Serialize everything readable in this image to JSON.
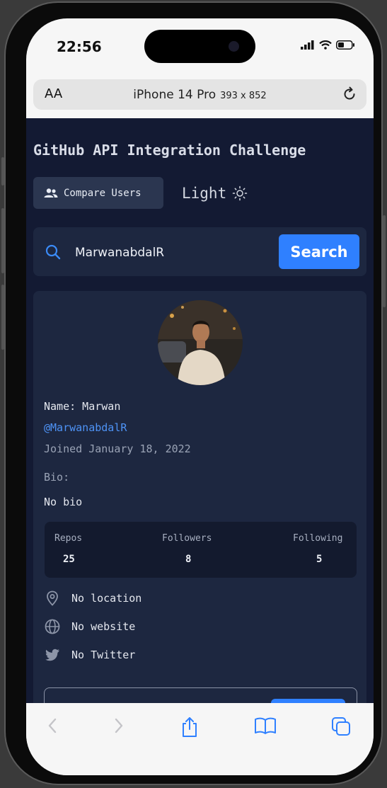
{
  "status": {
    "time": "22:56"
  },
  "browser": {
    "aa": "AA",
    "device": "iPhone 14 Pro",
    "size": "393 x 852"
  },
  "page": {
    "title": "GitHub API Integration Challenge",
    "compare_label": "Compare Users",
    "theme_label": "Light",
    "search_value": "MarwanabdalR",
    "search_button": "Search"
  },
  "profile": {
    "name": "Name: Marwan",
    "login": "@MarwanabdalR",
    "joined": "Joined January 18, 2022",
    "bio_label": "Bio:",
    "bio": "No bio",
    "stats": [
      {
        "label": "Repos",
        "value": "25"
      },
      {
        "label": "Followers",
        "value": "8"
      },
      {
        "label": "Following",
        "value": "5"
      }
    ],
    "location": "No location",
    "website": "No website",
    "twitter": "No Twitter"
  },
  "colors": {
    "background": "#131a33",
    "card": "#1d2740",
    "accent": "#2f80ff",
    "link": "#4e93f6"
  },
  "icons": [
    "users-icon",
    "sun-icon",
    "search-icon",
    "location-pin-icon",
    "globe-icon",
    "twitter-icon",
    "back-icon",
    "forward-icon",
    "share-icon",
    "bookmarks-icon",
    "tabs-icon",
    "reload-icon",
    "signal-icon",
    "wifi-icon",
    "battery-icon"
  ]
}
